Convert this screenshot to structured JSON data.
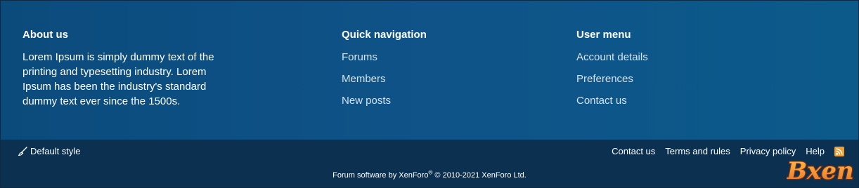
{
  "about": {
    "title": "About us",
    "text": "Lorem Ipsum is simply dummy text of the printing and typesetting industry. Lorem Ipsum has been the industry's standard dummy text ever since the 1500s."
  },
  "quick_nav": {
    "title": "Quick navigation",
    "links": [
      "Forums",
      "Members",
      "New posts"
    ]
  },
  "user_menu": {
    "title": "User menu",
    "links": [
      "Account details",
      "Preferences",
      "Contact us"
    ]
  },
  "footer": {
    "style_label": "Default style",
    "links": [
      "Contact us",
      "Terms and rules",
      "Privacy policy",
      "Help"
    ],
    "copyright_prefix": "Forum software by XenForo",
    "copyright_mark": "®",
    "copyright_suffix": " © 2010-2021 XenForo Ltd.",
    "watermark": "Bxen"
  },
  "icons": {
    "style": "paintbrush-icon",
    "feed": "rss-icon"
  },
  "colors": {
    "footer_upper": "#0f5388",
    "footer_lower": "#0c3150",
    "link_text": "#d6e3f0",
    "rss_orange": "#f0a030",
    "logo_orange": "#e8702a"
  }
}
